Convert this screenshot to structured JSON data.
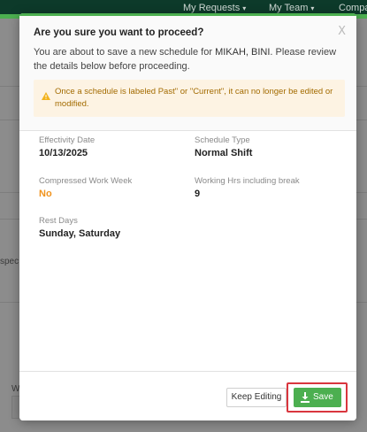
{
  "background": {
    "nav": [
      {
        "label": "My Requests"
      },
      {
        "label": "My Team"
      },
      {
        "label": "Compa"
      }
    ],
    "fragment_left": "spec",
    "fragment_bottom": "W"
  },
  "modal": {
    "title": "Are you sure you want to proceed?",
    "close_icon": "close-icon",
    "description_prefix": "You are about to save a new schedule for ",
    "employee_name": "MIKAH, BINI",
    "description_suffix": ". Please review the details below before proceeding.",
    "warning": {
      "icon": "warning-icon",
      "text": "Once a schedule is labeled Past\" or \"Current\", it can no longer be edited or modified."
    },
    "fields": {
      "effectivity_date": {
        "label": "Effectivity Date",
        "value": "10/13/2025"
      },
      "schedule_type": {
        "label": "Schedule Type",
        "value": "Normal Shift"
      },
      "compressed_work_week": {
        "label": "Compressed Work Week",
        "value": "No"
      },
      "working_hrs": {
        "label": "Working Hrs including break",
        "value": "9"
      },
      "rest_days": {
        "label": "Rest Days",
        "value": "Sunday, Saturday"
      }
    },
    "footer": {
      "keep_editing_label": "Keep Editing",
      "save_label": "Save",
      "save_icon": "download-icon"
    }
  },
  "colors": {
    "accent_green": "#4caf50",
    "warning_text": "#a36b00",
    "warning_bg": "#fdf3e3",
    "value_orange": "#f0931d",
    "highlight_red": "#d9363e"
  }
}
